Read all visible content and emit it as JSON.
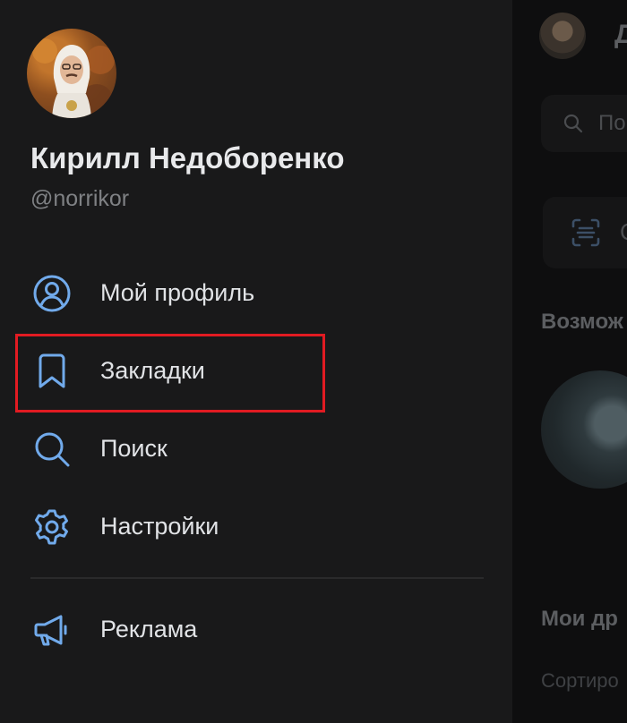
{
  "background_screen": {
    "title_fragment": "Д",
    "search_placeholder_fragment": "По",
    "card_label_fragment": "С",
    "section_possible": "Возмож",
    "section_friends": "Мои др",
    "sort_label": "Сортиро"
  },
  "profile": {
    "name": "Кирилл Недоборенко",
    "handle": "@norrikor"
  },
  "menu": {
    "items": [
      {
        "label": "Мой профиль",
        "icon": "user-circle-icon"
      },
      {
        "label": "Закладки",
        "icon": "bookmark-icon"
      },
      {
        "label": "Поиск",
        "icon": "search-icon"
      },
      {
        "label": "Настройки",
        "icon": "gear-icon"
      }
    ],
    "extra": [
      {
        "label": "Реклама",
        "icon": "megaphone-icon"
      }
    ]
  },
  "annotation": {
    "highlighted_item": "Закладки",
    "color": "#e11b22"
  },
  "colors": {
    "accent": "#71aaeb",
    "drawer_bg": "#19191a",
    "text": "#e1e3e6"
  }
}
